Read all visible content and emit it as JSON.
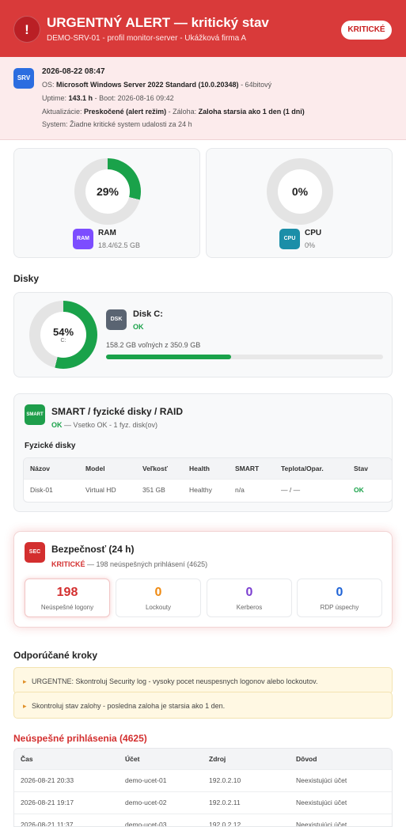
{
  "header": {
    "alert_icon_glyph": "!",
    "title": "URGENTNÝ ALERT — kritický stav",
    "subtitle": "DEMO-SRV-01 - profil monitor-server - Ukážková firma A",
    "badge": "KRITICKÉ"
  },
  "system": {
    "icon_label": "SRV",
    "datetime": "2026-08-22 08:47",
    "os_label": "OS:",
    "os_value": "Microsoft Windows Server 2022 Standard (10.0.20348)",
    "os_arch": "- 64bitový",
    "uptime_label": "Uptime:",
    "uptime_value": "143.1 h",
    "boot_text": "- Boot: 2026-08-16 09:42",
    "updates_label": "Aktualizácie:",
    "updates_value": "Preskočené (alert režim)",
    "backup_label": "- Záloha:",
    "backup_value": "Zaloha starsia ako 1 den (1 dni)",
    "events_text": "System: Žiadne kritické system udalosti za 24 h"
  },
  "metrics": {
    "ram": {
      "percent": 29,
      "percent_label": "29%",
      "icon": "RAM",
      "name": "RAM",
      "sub": "18.4/62.5 GB"
    },
    "cpu": {
      "percent": 0,
      "percent_label": "0%",
      "icon": "CPU",
      "name": "CPU",
      "sub": "0%"
    }
  },
  "disks": {
    "section_title": "Disky",
    "disk_c": {
      "percent": 54,
      "percent_label": "54%",
      "drive": "C:",
      "icon": "DSK",
      "name": "Disk C:",
      "status": "OK",
      "free_text": "158.2 GB voľných z 350.9 GB",
      "free_fraction": 0.45
    }
  },
  "smart": {
    "icon": "SMART",
    "title": "SMART / fyzické disky / RAID",
    "status": "OK",
    "status_detail": "— Vsetko OK - 1 fyz. disk(ov)",
    "subheading": "Fyzické disky",
    "columns": [
      "Názov",
      "Model",
      "Veľkosť",
      "Health",
      "SMART",
      "Teplota/Opar.",
      "Stav"
    ],
    "rows": [
      [
        "Disk-01",
        "Virtual HD",
        "351 GB",
        "Healthy",
        "n/a",
        "— / —",
        "OK"
      ]
    ]
  },
  "security": {
    "icon": "SEC",
    "title": "Bezpečnosť (24 h)",
    "status": "KRITICKÉ",
    "status_detail": "— 198 neúspešných prihlásení (4625)",
    "stats": [
      {
        "value": "198",
        "label": "Neúspešné logony",
        "color": "#d32f2f"
      },
      {
        "value": "0",
        "label": "Lockouty",
        "color": "#ef8a12"
      },
      {
        "value": "0",
        "label": "Kerberos",
        "color": "#7b3fd0"
      },
      {
        "value": "0",
        "label": "RDP úspechy",
        "color": "#1f63d6"
      }
    ]
  },
  "recommendations": {
    "section_title": "Odporúčané kroky",
    "items": [
      "URGENTNE: Skontroluj Security log - vysoky pocet neuspesnych logonov alebo lockoutov.",
      "Skontroluj stav zalohy - posledna zaloha je starsia ako 1 den."
    ]
  },
  "failed_logins": {
    "section_title": "Neúspešné prihlásenia (4625)",
    "columns": [
      "Čas",
      "Účet",
      "Zdroj",
      "Dôvod"
    ],
    "rows": [
      [
        "2026-08-21 20:33",
        "demo-ucet-01",
        "192.0.2.10",
        "Neexistujúci účet"
      ],
      [
        "2026-08-21 19:17",
        "demo-ucet-02",
        "192.0.2.11",
        "Neexistujúci účet"
      ],
      [
        "2026-08-21 11:37",
        "demo-ucet-03",
        "192.0.2.12",
        "Neexistujúci účet"
      ]
    ]
  },
  "colors": {
    "header_red": "#d93a3a",
    "ok_green": "#1aa24a",
    "critical_red": "#d32f2f",
    "ram_purple": "#7c4dff",
    "cpu_teal": "#1b8ea8",
    "disk_gray": "#5a6472",
    "smart_green": "#1e9e4b",
    "sec_red": "#d32f2f"
  }
}
